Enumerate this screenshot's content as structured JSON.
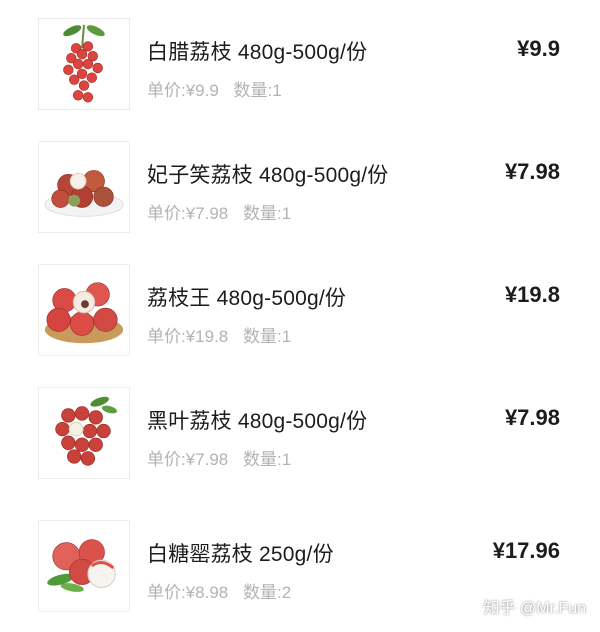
{
  "products": [
    {
      "title": "白腊荔枝 480g-500g/份",
      "unit_price": "单价:¥9.9",
      "quantity": "数量:1",
      "total": "¥9.9",
      "thumbnail": "lychee-bunch-icon"
    },
    {
      "title": "妃子笑荔枝 480g-500g/份",
      "unit_price": "单价:¥7.98",
      "quantity": "数量:1",
      "total": "¥7.98",
      "thumbnail": "lychee-plate-icon"
    },
    {
      "title": "荔枝王 480g-500g/份",
      "unit_price": "单价:¥19.8",
      "quantity": "数量:1",
      "total": "¥19.8",
      "thumbnail": "lychee-bowl-icon"
    },
    {
      "title": "黑叶荔枝 480g-500g/份",
      "unit_price": "单价:¥7.98",
      "quantity": "数量:1",
      "total": "¥7.98",
      "thumbnail": "lychee-pile-icon"
    },
    {
      "title": "白糖罂荔枝 250g/份",
      "unit_price": "单价:¥8.98",
      "quantity": "数量:2",
      "total": "¥17.96",
      "thumbnail": "lychee-leaf-icon"
    }
  ],
  "watermark": "知乎 @Mr.Fun",
  "colors": {
    "price_text": "#1c1c1c",
    "meta_text": "#b3b3b3",
    "lychee_red": "#d9453f"
  }
}
